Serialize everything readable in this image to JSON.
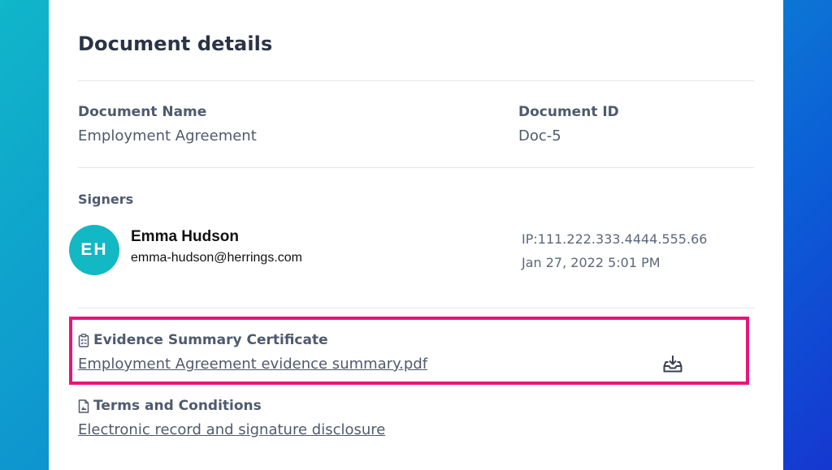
{
  "card": {
    "title": "Document details"
  },
  "document": {
    "name_label": "Document Name",
    "name_value": "Employment Agreement",
    "id_label": "Document ID",
    "id_value": "Doc-5"
  },
  "signers": {
    "label": "Signers",
    "items": [
      {
        "initials": "EH",
        "name": "Emma Hudson",
        "email": "emma-hudson@herrings.com",
        "ip": "IP:111.222.333.4444.555.66",
        "timestamp": "Jan 27, 2022 5:01 PM",
        "avatar_color": "#12b8c4"
      }
    ]
  },
  "evidence": {
    "heading": "Evidence Summary Certificate",
    "file_link": "Employment Agreement evidence summary.pdf",
    "icon": "clipboard-list-icon",
    "action_icon": "download-tray-icon",
    "highlight_color": "#e8157a"
  },
  "terms": {
    "heading": "Terms and Conditions",
    "link": "Electronic record and signature disclosure",
    "icon": "document-icon"
  }
}
